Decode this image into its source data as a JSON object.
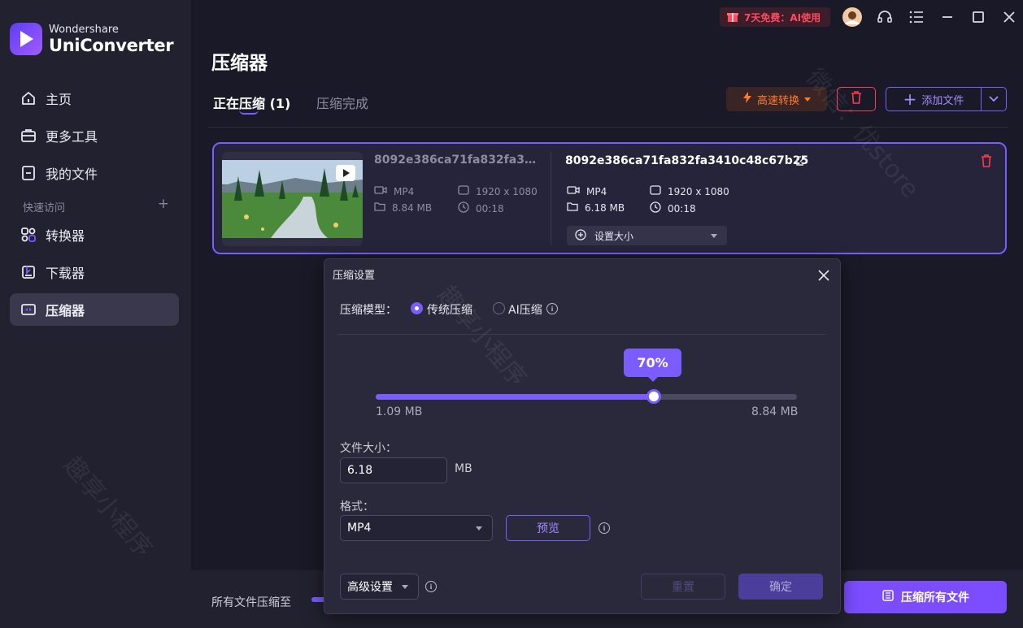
{
  "app": {
    "brand": "Wondershare",
    "product": "UniConverter"
  },
  "sidebar": {
    "items": [
      {
        "label": "主页",
        "icon": "home-icon"
      },
      {
        "label": "更多工具",
        "icon": "toolbox-icon"
      },
      {
        "label": "我的文件",
        "icon": "file-icon"
      },
      {
        "label": "转换器",
        "icon": "converter-icon"
      },
      {
        "label": "下载器",
        "icon": "downloader-icon"
      },
      {
        "label": "压缩器",
        "icon": "compressor-icon",
        "active": true
      }
    ],
    "section_label": "快速访问",
    "section_add": "+"
  },
  "topbar": {
    "promo_text": "7天免费：AI使用",
    "icons": [
      "gift-icon",
      "avatar",
      "headset-icon",
      "menu-icon",
      "minimize-icon",
      "maximize-icon",
      "close-icon"
    ]
  },
  "main": {
    "title": "压缩器",
    "tabs": [
      {
        "label": "正在压缩 (1)",
        "active": true
      },
      {
        "label": "压缩完成",
        "active": false
      }
    ],
    "speed_button": "高速转换",
    "add_button": "添加文件"
  },
  "file": {
    "source_name": "8092e386ca71fa832fa3410c48c67b25",
    "source_format": "MP4",
    "source_size": "8.84 MB",
    "source_resolution": "1920 x 1080",
    "source_duration": "00:18",
    "target_name": "8092e386ca71fa832fa3410c48c67b25",
    "target_format": "MP4",
    "target_size": "6.18 MB",
    "target_resolution": "1920 x 1080",
    "target_duration": "00:18",
    "size_select": "设置大小"
  },
  "dialog": {
    "title": "压缩设置",
    "mode_label": "压缩模型：",
    "mode_options": [
      "传统压缩",
      "AI压缩"
    ],
    "mode_selected": "传统压缩",
    "percent_label": "70%",
    "percent_value": 0.66,
    "range_min": "1.09 MB",
    "range_max": "8.84 MB",
    "size_label": "文件大小：",
    "size_value": "6.18",
    "size_unit": "MB",
    "format_label": "格式：",
    "format_value": "MP4",
    "preview_button": "预览",
    "advanced_label": "高级设置",
    "reset_button": "重置",
    "ok_button": "确定"
  },
  "bottom": {
    "label": "所有文件压缩至",
    "compress_all_button": "压缩所有文件"
  },
  "colors": {
    "accent": "#7b5cff",
    "danger": "#ff3b4e",
    "speed": "#ff7a2e",
    "background": "#1a1927",
    "sidebar": "#22212f"
  },
  "watermarks": [
    "趣享小程序",
    "微信：优store"
  ]
}
